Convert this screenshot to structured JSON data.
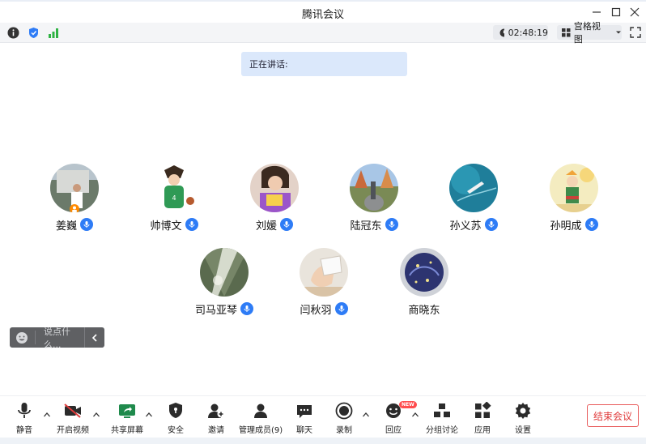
{
  "window": {
    "title": "腾讯会议"
  },
  "toolbar": {
    "timer": "02:48:19",
    "view_label": "宫格视图"
  },
  "speaking": {
    "label": "正在讲话:"
  },
  "participants": [
    {
      "name": "姜巍"
    },
    {
      "name": "帅博文"
    },
    {
      "name": "刘媛"
    },
    {
      "name": "陆冠东"
    },
    {
      "name": "孙义苏"
    },
    {
      "name": "孙明成"
    },
    {
      "name": "司马亚琴"
    },
    {
      "name": "闫秋羽"
    },
    {
      "name": "商晓东"
    }
  ],
  "chat": {
    "placeholder": "说点什么..."
  },
  "bottom": {
    "mute": "静音",
    "video": "开启视频",
    "share": "共享屏幕",
    "security": "安全",
    "invite": "邀请",
    "members": "管理成员(9)",
    "chat": "聊天",
    "record": "录制",
    "react": "回应",
    "new_badge": "NEW",
    "breakout": "分组讨论",
    "apps": "应用",
    "settings": "设置",
    "end": "结束会议"
  },
  "colors": {
    "accent": "#2e7cf6",
    "end": "#e03b3b",
    "speaking_bg": "#dbe8fb"
  }
}
